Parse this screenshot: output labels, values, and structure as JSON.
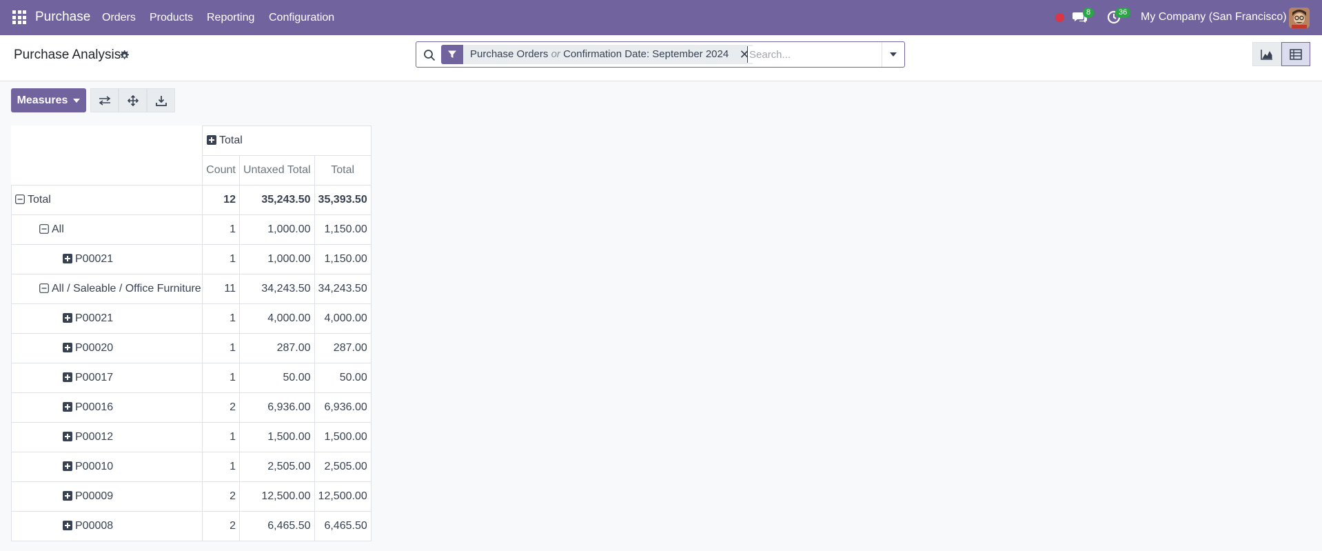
{
  "navbar": {
    "app_name": "Purchase",
    "menus": [
      "Orders",
      "Products",
      "Reporting",
      "Configuration"
    ],
    "chat_badge": "8",
    "activity_badge": "36",
    "company": "My Company (San Francisco)",
    "accent_color": "#71639e"
  },
  "control_panel": {
    "title": "Purchase Analysis",
    "search": {
      "facet_part1": "Purchase Orders",
      "facet_or": "or",
      "facet_part2": "Confirmation Date: September 2024",
      "placeholder": "Search..."
    },
    "views": [
      "graph",
      "pivot"
    ],
    "active_view": "pivot"
  },
  "toolbar": {
    "measures_label": "Measures"
  },
  "pivot": {
    "column_header": "Total",
    "measures": [
      "Count",
      "Untaxed Total",
      "Total"
    ],
    "rows": [
      {
        "label": "Total",
        "level": 0,
        "expanded": true,
        "count": "12",
        "untaxed": "35,243.50",
        "total": "35,393.50"
      },
      {
        "label": "All",
        "level": 1,
        "expanded": true,
        "count": "1",
        "untaxed": "1,000.00",
        "total": "1,150.00"
      },
      {
        "label": "P00021",
        "level": 2,
        "expanded": false,
        "count": "1",
        "untaxed": "1,000.00",
        "total": "1,150.00"
      },
      {
        "label": "All / Saleable / Office Furniture",
        "level": 1,
        "expanded": true,
        "count": "11",
        "untaxed": "34,243.50",
        "total": "34,243.50"
      },
      {
        "label": "P00021",
        "level": 2,
        "expanded": false,
        "count": "1",
        "untaxed": "4,000.00",
        "total": "4,000.00"
      },
      {
        "label": "P00020",
        "level": 2,
        "expanded": false,
        "count": "1",
        "untaxed": "287.00",
        "total": "287.00"
      },
      {
        "label": "P00017",
        "level": 2,
        "expanded": false,
        "count": "1",
        "untaxed": "50.00",
        "total": "50.00"
      },
      {
        "label": "P00016",
        "level": 2,
        "expanded": false,
        "count": "2",
        "untaxed": "6,936.00",
        "total": "6,936.00"
      },
      {
        "label": "P00012",
        "level": 2,
        "expanded": false,
        "count": "1",
        "untaxed": "1,500.00",
        "total": "1,500.00"
      },
      {
        "label": "P00010",
        "level": 2,
        "expanded": false,
        "count": "1",
        "untaxed": "2,505.00",
        "total": "2,505.00"
      },
      {
        "label": "P00009",
        "level": 2,
        "expanded": false,
        "count": "2",
        "untaxed": "12,500.00",
        "total": "12,500.00"
      },
      {
        "label": "P00008",
        "level": 2,
        "expanded": false,
        "count": "2",
        "untaxed": "6,465.50",
        "total": "6,465.50"
      }
    ]
  }
}
